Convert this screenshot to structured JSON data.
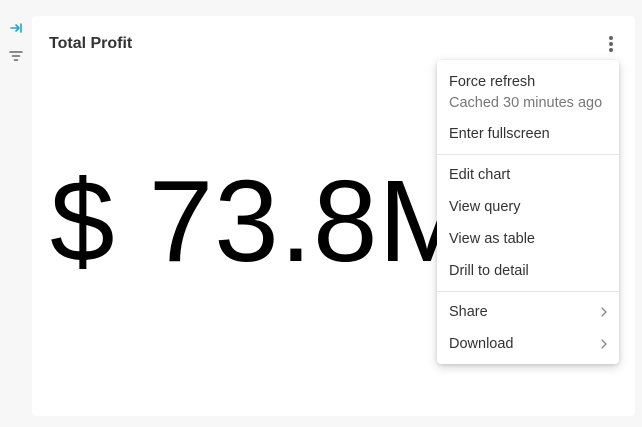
{
  "sidebar": {
    "expand_icon": "expand-right-icon",
    "filter_icon": "filter-icon",
    "accent": "#20a7c9"
  },
  "card": {
    "title": "Total Profit",
    "value": "$ 73.8M",
    "menu_icon": "kebab-menu-icon"
  },
  "menu": {
    "force_refresh": "Force refresh",
    "cached_note": "Cached 30 minutes ago",
    "enter_fullscreen": "Enter fullscreen",
    "edit_chart": "Edit chart",
    "view_query": "View query",
    "view_as_table": "View as table",
    "drill_to_detail": "Drill to detail",
    "share": "Share",
    "download": "Download",
    "submenu_icon": "chevron-right-icon"
  }
}
